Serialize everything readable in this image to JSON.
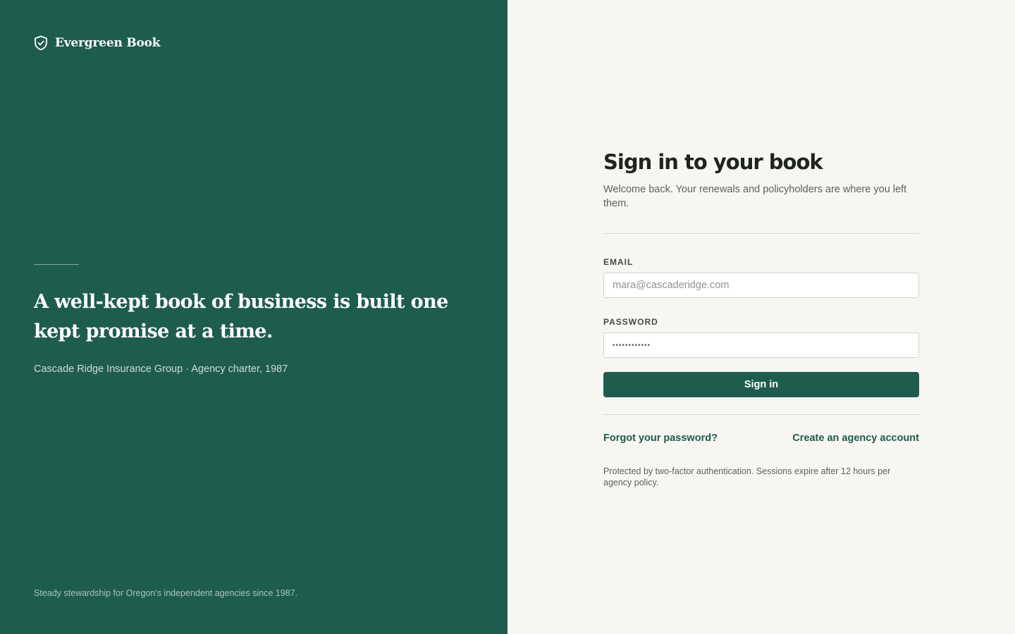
{
  "brand": {
    "name": "Evergreen Book",
    "icon": "shield-check-icon"
  },
  "hero": {
    "quote": "A well-kept book of business is built one kept promise at a time.",
    "attribution": "Cascade Ridge Insurance Group · Agency charter, 1987",
    "footer": "Steady stewardship for Oregon's independent agencies since 1987."
  },
  "form": {
    "title": "Sign in to your book",
    "subtitle": "Welcome back. Your renewals and policyholders are where you left them.",
    "email_label": "EMAIL",
    "email_placeholder": "mara@cascaderidge.com",
    "email_value": "",
    "password_label": "PASSWORD",
    "password_value": "••••••••••••",
    "submit_label": "Sign in",
    "forgot_label": "Forgot your password?",
    "create_label": "Create an agency account",
    "fine_print": "Protected by two-factor authentication. Sessions expire after 12 hours per agency policy."
  },
  "colors": {
    "brand_green": "#1e5c4e",
    "panel_background": "#f7f6f2",
    "text_dark": "#1f2421"
  }
}
